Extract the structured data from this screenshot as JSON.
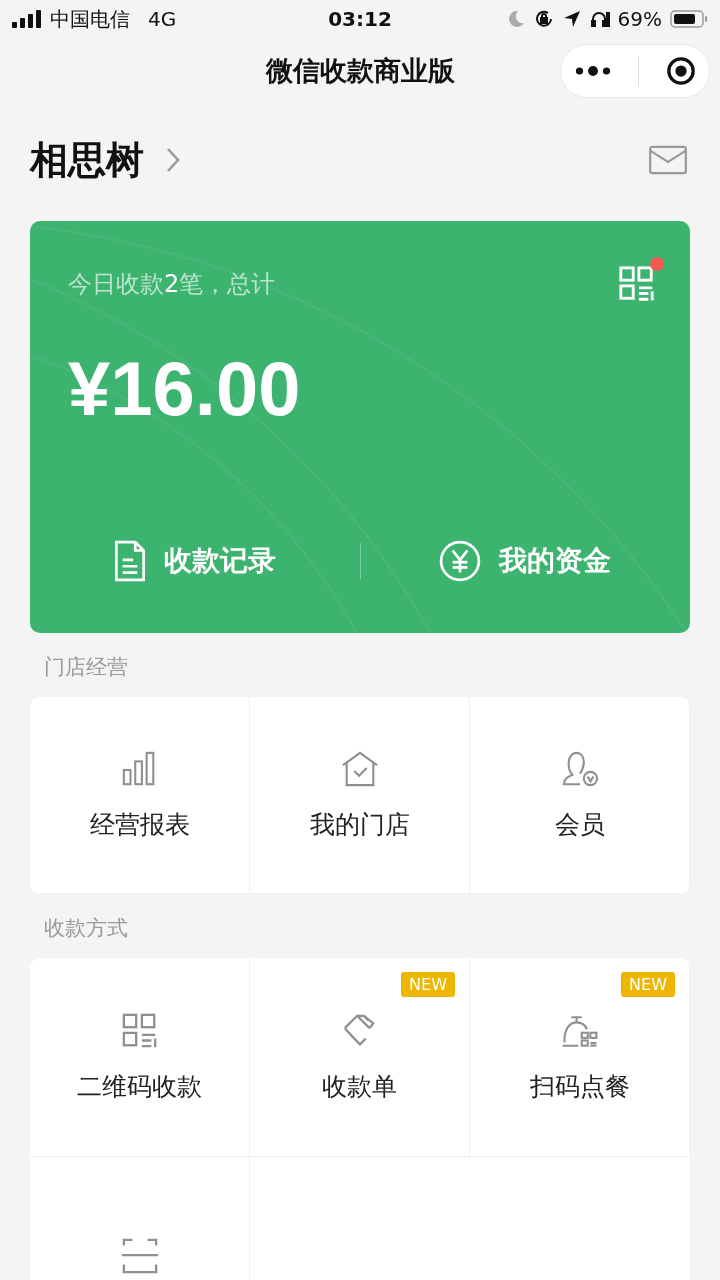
{
  "status_bar": {
    "carrier": "中国电信",
    "network": "4G",
    "time": "03:12",
    "battery": "69%"
  },
  "nav": {
    "title": "微信收款商业版"
  },
  "header": {
    "store_name": "相思树"
  },
  "summary_card": {
    "caption": "今日收款**2**笔，总计",
    "amount": "¥16.00",
    "qr_badge": true,
    "actions": [
      {
        "label": "收款记录",
        "kind": "document"
      },
      {
        "label": "我的资金",
        "kind": "yuan"
      }
    ]
  },
  "sections": [
    {
      "title": "门店经营",
      "items": [
        {
          "label": "经营报表",
          "kind": "bars"
        },
        {
          "label": "我的门店",
          "kind": "house"
        },
        {
          "label": "会员",
          "kind": "member"
        }
      ]
    },
    {
      "title": "收款方式",
      "items": [
        {
          "label": "二维码收款",
          "kind": "qr"
        },
        {
          "label": "收款单",
          "kind": "ticket",
          "badge": "NEW"
        },
        {
          "label": "扫码点餐",
          "kind": "bell",
          "badge": "NEW"
        },
        {
          "kind": "scan"
        }
      ]
    }
  ]
}
